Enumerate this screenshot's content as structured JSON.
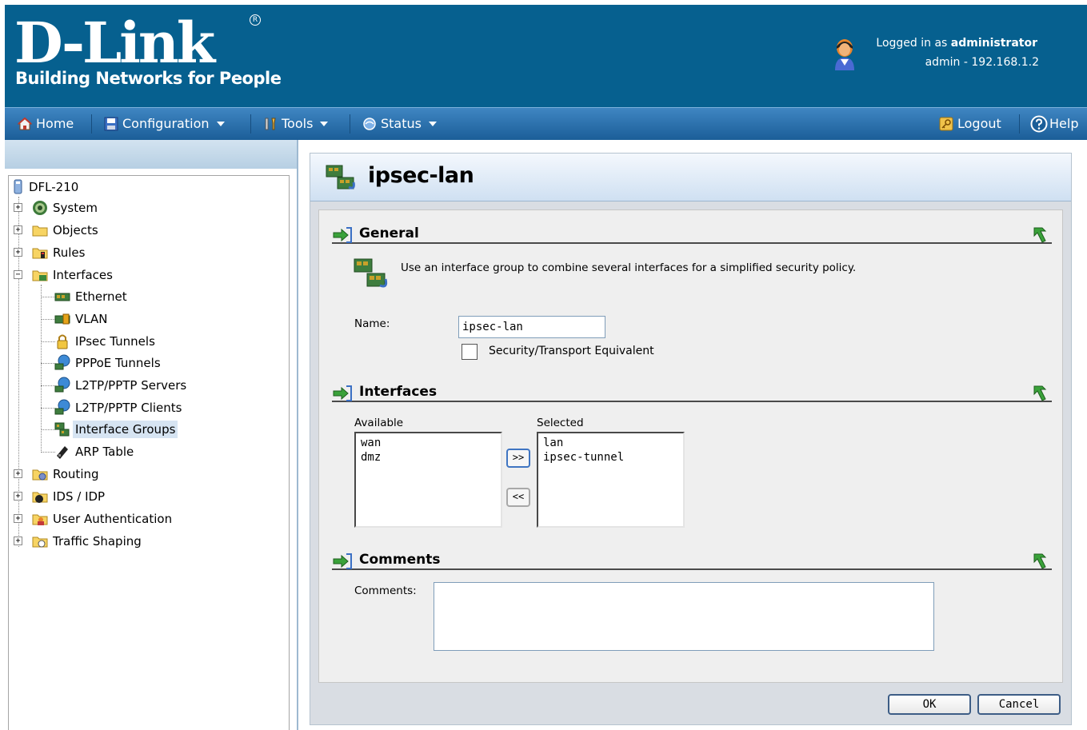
{
  "header": {
    "brand": "D-Link",
    "registered_mark": "R",
    "tagline": "Building Networks for People",
    "logged_in_prefix": "Logged in as ",
    "logged_in_user": "administrator",
    "session_info": "admin - 192.168.1.2"
  },
  "menu": {
    "home": "Home",
    "configuration": "Configuration",
    "tools": "Tools",
    "status": "Status",
    "logout": "Logout",
    "help": "Help"
  },
  "tree": {
    "root": "DFL-210",
    "items": [
      {
        "label": "System",
        "icon": "gear-icon"
      },
      {
        "label": "Objects",
        "icon": "folder-icon"
      },
      {
        "label": "Rules",
        "icon": "rules-folder-icon"
      },
      {
        "label": "Interfaces",
        "icon": "interfaces-folder-icon"
      },
      {
        "label": "Ethernet",
        "icon": "ethernet-card-icon"
      },
      {
        "label": "VLAN",
        "icon": "vlan-icon"
      },
      {
        "label": "IPsec Tunnels",
        "icon": "lock-icon"
      },
      {
        "label": "PPPoE Tunnels",
        "icon": "globe-computer-icon"
      },
      {
        "label": "L2TP/PPTP Servers",
        "icon": "globe-computer-icon"
      },
      {
        "label": "L2TP/PPTP Clients",
        "icon": "globe-computer-icon"
      },
      {
        "label": "Interface Groups",
        "icon": "interface-group-icon"
      },
      {
        "label": "ARP Table",
        "icon": "arp-icon"
      },
      {
        "label": "Routing",
        "icon": "routing-folder-icon"
      },
      {
        "label": "IDS / IDP",
        "icon": "ids-folder-icon"
      },
      {
        "label": "User Authentication",
        "icon": "user-auth-folder-icon"
      },
      {
        "label": "Traffic Shaping",
        "icon": "traffic-folder-icon"
      }
    ]
  },
  "page": {
    "title": "ipsec-lan"
  },
  "general": {
    "heading": "General",
    "description": "Use an interface group to combine several interfaces for a simplified security policy.",
    "name_label": "Name:",
    "name_value": "ipsec-lan",
    "equivalent_label": "Security/Transport Equivalent",
    "equivalent_checked": false
  },
  "interfaces": {
    "heading": "Interfaces",
    "available_label": "Available",
    "selected_label": "Selected",
    "available": [
      "wan",
      "dmz"
    ],
    "selected": [
      "lan",
      "ipsec-tunnel"
    ],
    "add_button": ">>",
    "remove_button": "<<"
  },
  "comments": {
    "heading": "Comments",
    "label": "Comments:",
    "value": ""
  },
  "footer": {
    "ok": "OK",
    "cancel": "Cancel"
  },
  "colors": {
    "header_bg": "#06608f",
    "menubar_top": "#3f86c2",
    "menubar_bottom": "#1b5e98",
    "selected_tree_bg": "#d6e4f2"
  }
}
